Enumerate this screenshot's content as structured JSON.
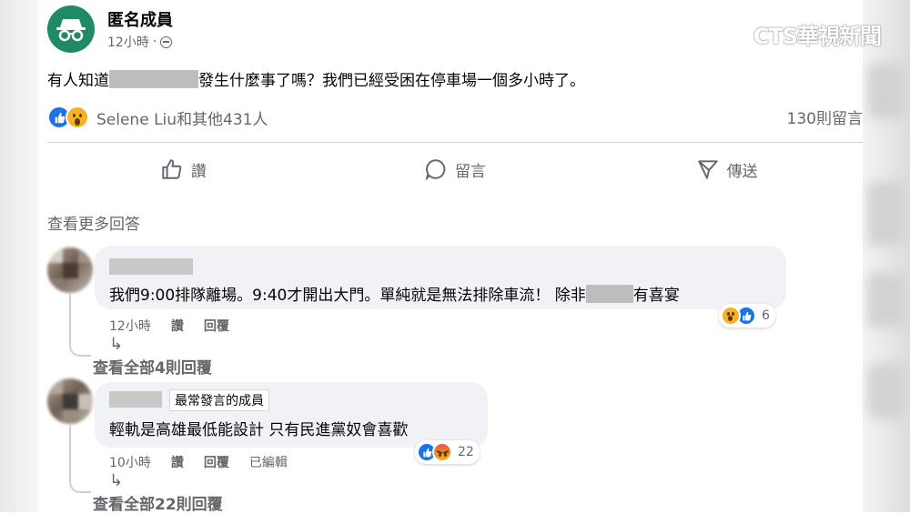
{
  "watermark": "CTS華視新聞",
  "post": {
    "author": "匿名成員",
    "time": "12小時",
    "dot": "·",
    "text_before": "有人知道",
    "text_after": "發生什麼事了嗎？我們已經受困在停車場一個多小時了。",
    "reaction_summary": "Selene Liu和其他431人",
    "comment_count": "130則留言"
  },
  "actions": [
    {
      "label": "讚",
      "icon": "thumbs-up-icon"
    },
    {
      "label": "留言",
      "icon": "comment-icon"
    },
    {
      "label": "傳送",
      "icon": "send-icon"
    }
  ],
  "see_more_replies": "查看更多回答",
  "comments": [
    {
      "text_before": "我們9:00排隊離場。9:40才開出大門。單純就是無法排除車流！ 除非",
      "text_after": "有喜宴",
      "time": "12小時",
      "like": "讚",
      "reply": "回覆",
      "reaction_count": "6",
      "reactions": [
        "wow",
        "like"
      ],
      "view_replies": "查看全部4則回覆"
    },
    {
      "badge": "最常發言的成員",
      "text": "輕軌是高雄最低能設計 只有民進黨奴會喜歡",
      "time": "10小時",
      "like": "讚",
      "reply": "回覆",
      "edited": "已編輯",
      "reaction_count": "22",
      "reactions": [
        "like",
        "angry"
      ],
      "view_replies": "查看全部22則回覆"
    }
  ],
  "colors": {
    "avatar_bg": "#1f8a63",
    "like_blue": "#1b74e4",
    "wow_yellow": "#f7b125",
    "secondary_text": "#65676b",
    "bubble_bg": "#f0f2f5"
  }
}
